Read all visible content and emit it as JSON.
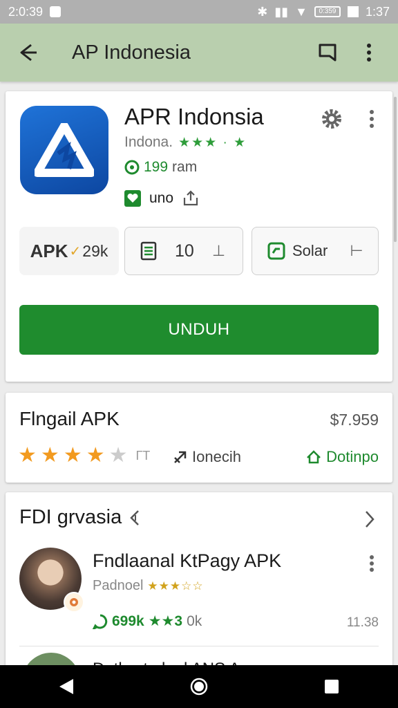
{
  "status_bar": {
    "time": "2:0:39",
    "battery": "0:359",
    "clock_right": "1:37"
  },
  "app_bar": {
    "title": "AP Indonesia"
  },
  "app": {
    "name": "APR Indonsia",
    "developer": "Indona.",
    "rating_stars": "★★★ · ★",
    "downloads": "199",
    "downloads_unit": "ram",
    "wishlist_label": "uno"
  },
  "chips": {
    "apk_label": "APK",
    "apk_size": "29k",
    "count": "10",
    "solar": "Solar"
  },
  "install_button": "UNDUH",
  "card2": {
    "title": "Flngail APK",
    "price": "$7.959",
    "rating_count": "ГТ",
    "launch_label": "Ionecih",
    "download_label": "Dotinpo"
  },
  "card3": {
    "title": "FDI grvasia",
    "item": {
      "title": "Fndlaanal KtPagy APK",
      "developer": "Padnoel",
      "stars": "★★★☆☆",
      "stat_downloads": "699k",
      "stat_mid": "★★3",
      "stat_grey": "0k",
      "size": "11.38"
    },
    "next_item_partial": "Dntlpwtmlanl ANS A"
  },
  "colors": {
    "accent": "#1f8c2e",
    "appbar": "#b9cfae",
    "icon_blue": "#1f73d8",
    "star_orange": "#f29a1f"
  },
  "icons": [
    "back-arrow-icon",
    "bookmark-icon",
    "more-vert-icon",
    "gear-icon",
    "share-icon",
    "heart-icon",
    "list-icon",
    "chat-icon",
    "chevron-right-icon",
    "launch-icon",
    "download-icon"
  ]
}
